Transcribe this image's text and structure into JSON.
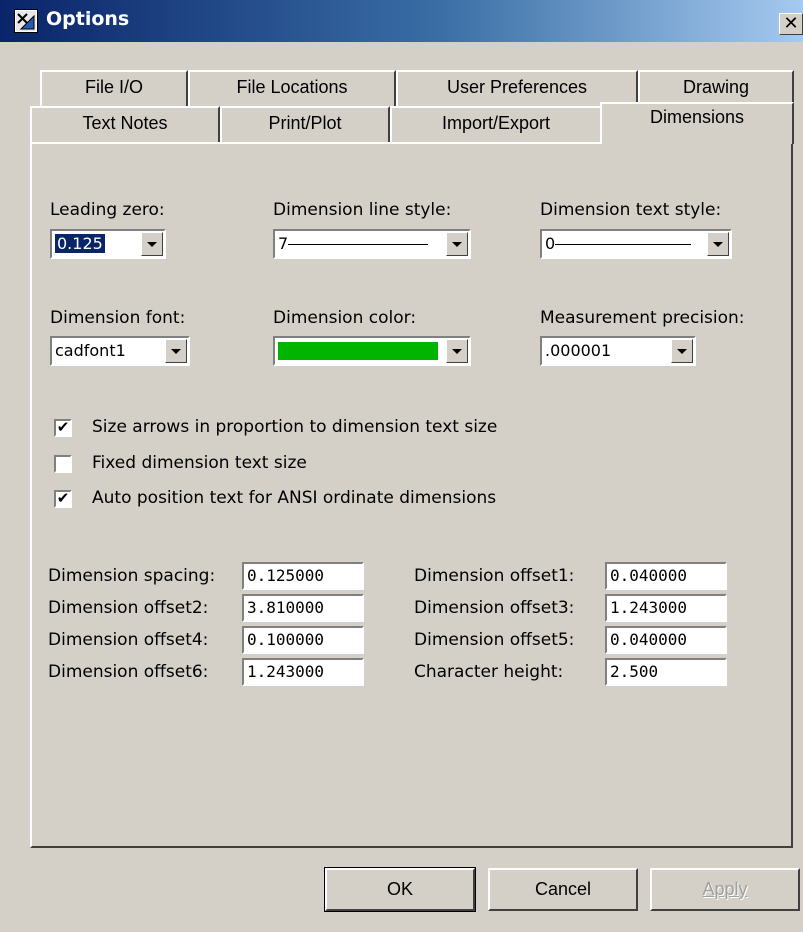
{
  "window": {
    "title": "Options"
  },
  "tabs_row1": [
    "File I/O",
    "File Locations",
    "User Preferences",
    "Drawing"
  ],
  "tabs_row2": [
    "Text Notes",
    "Print/Plot",
    "Import/Export",
    "Dimensions"
  ],
  "active_tab": "Dimensions",
  "dropdowns": {
    "leading_zero": {
      "label": "Leading zero:",
      "value": "0.125"
    },
    "line_style": {
      "label": "Dimension line style:",
      "value": "7"
    },
    "text_style": {
      "label": "Dimension text style:",
      "value": "0"
    },
    "font": {
      "label": "Dimension font:",
      "value": "cadfont1"
    },
    "color": {
      "label": "Dimension color:",
      "value": "#00b400"
    },
    "precision": {
      "label": "Measurement precision:",
      "value": ".000001"
    }
  },
  "checkboxes": [
    {
      "label": "Size arrows in proportion to dimension text size",
      "checked": true,
      "mark": "✔"
    },
    {
      "label": "Fixed dimension text size",
      "checked": false,
      "mark": ""
    },
    {
      "label": "Auto position text for ANSI ordinate dimensions",
      "checked": true,
      "mark": "✔"
    }
  ],
  "fields_left": [
    {
      "label": "Dimension spacing:",
      "value": "0.125000"
    },
    {
      "label": "Dimension offset2:",
      "value": "3.810000"
    },
    {
      "label": "Dimension offset4:",
      "value": "0.100000"
    },
    {
      "label": "Dimension offset6:",
      "value": "1.243000"
    }
  ],
  "fields_right": [
    {
      "label": "Dimension offset1:",
      "value": "0.040000"
    },
    {
      "label": "Dimension offset3:",
      "value": "1.243000"
    },
    {
      "label": "Dimension offset5:",
      "value": "0.040000"
    },
    {
      "label": "Character height:",
      "value": "2.500"
    }
  ],
  "buttons": {
    "ok": "OK",
    "cancel": "Cancel",
    "apply": "Apply"
  }
}
